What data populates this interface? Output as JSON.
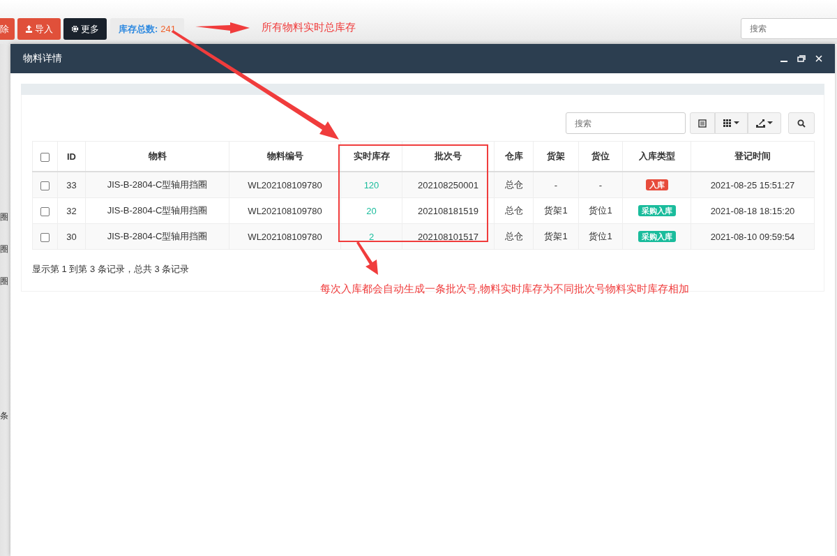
{
  "toolbar": {
    "buttons": [
      {
        "label": "除",
        "kind": "danger"
      },
      {
        "label": "导入",
        "kind": "danger"
      },
      {
        "label": "更多",
        "kind": "dark"
      }
    ],
    "stock_total": {
      "label": "库存总数:",
      "value": "241"
    },
    "search": {
      "placeholder": "搜索"
    }
  },
  "background_fragments": [
    "圈",
    "圈",
    "圈",
    "条"
  ],
  "modal": {
    "title": "物料详情",
    "search": {
      "placeholder": "搜索"
    },
    "table": {
      "header_checkbox": {
        "checked": false
      },
      "columns": [
        "ID",
        "物料",
        "物料编号",
        "实时库存",
        "批次号",
        "仓库",
        "货架",
        "货位",
        "入库类型",
        "登记时间"
      ],
      "rows": [
        {
          "checked": false,
          "id": "33",
          "material": "JIS-B-2804-C型轴用挡圈",
          "code": "WL202108109780",
          "stock": "120",
          "batch": "202108250001",
          "warehouse": "总仓",
          "shelf": "-",
          "slot": "-",
          "type": {
            "label": "入库",
            "color": "#e74c3c"
          },
          "time": "2021-08-25 15:51:27"
        },
        {
          "checked": false,
          "id": "32",
          "material": "JIS-B-2804-C型轴用挡圈",
          "code": "WL202108109780",
          "stock": "20",
          "batch": "202108181519",
          "warehouse": "总仓",
          "shelf": "货架1",
          "slot": "货位1",
          "type": {
            "label": "采购入库",
            "color": "#1abc9c"
          },
          "time": "2021-08-18 18:15:20"
        },
        {
          "checked": false,
          "id": "30",
          "material": "JIS-B-2804-C型轴用挡圈",
          "code": "WL202108109780",
          "stock": "2",
          "batch": "202108101517",
          "warehouse": "总仓",
          "shelf": "货架1",
          "slot": "货位1",
          "type": {
            "label": "采购入库",
            "color": "#1abc9c"
          },
          "time": "2021-08-10 09:59:54"
        }
      ]
    },
    "pagination": "显示第 1 到第 3 条记录，总共 3 条记录"
  },
  "annotations": [
    "所有物料实时总库存",
    "每次入库都会自动生成一条批次号,物料实时库存为不同批次号物料实时库存相加"
  ]
}
